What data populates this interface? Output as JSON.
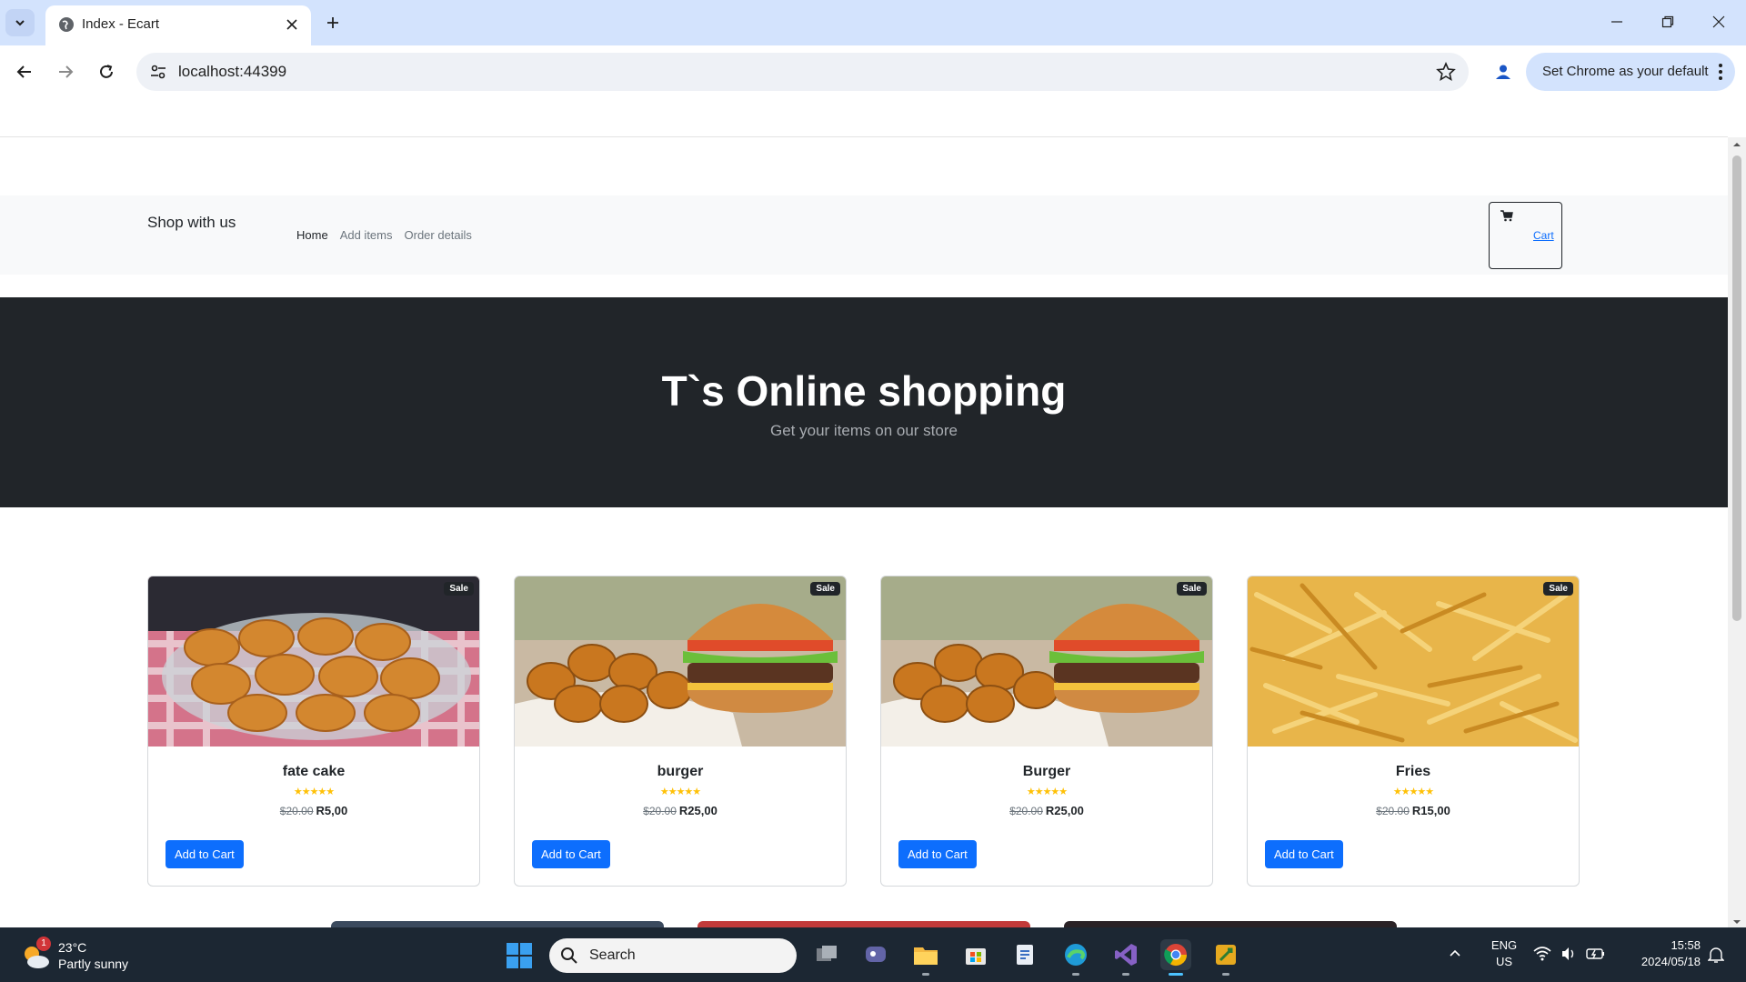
{
  "browser": {
    "tab_title": "Index - Ecart",
    "url": "localhost:44399",
    "default_prompt": "Set Chrome as your default"
  },
  "site": {
    "brand": "Shop with us",
    "nav": [
      "Home",
      "Add items",
      "Order details"
    ],
    "cart_label": "Cart"
  },
  "hero": {
    "title": "T`s Online shopping",
    "subtitle": "Get your items on our store"
  },
  "products": [
    {
      "name": "fate cake",
      "badge": "Sale",
      "old_price": "$20.00",
      "price": "R5,00",
      "rating": 5,
      "button": "Add to Cart",
      "image": "fried-dough-vetkoek-photo"
    },
    {
      "name": "burger",
      "badge": "Sale",
      "old_price": "$20.00",
      "price": "R25,00",
      "rating": 5,
      "button": "Add to Cart",
      "image": "burger-and-nuggets-photo"
    },
    {
      "name": "Burger",
      "badge": "Sale",
      "old_price": "$20.00",
      "price": "R25,00",
      "rating": 5,
      "button": "Add to Cart",
      "image": "burger-and-nuggets-photo"
    },
    {
      "name": "Fries",
      "badge": "Sale",
      "old_price": "$20.00",
      "price": "R15,00",
      "rating": 5,
      "button": "Add to Cart",
      "image": "french-fries-photo"
    }
  ],
  "taskbar": {
    "weather_temp": "23°C",
    "weather_desc": "Partly sunny",
    "weather_badge": "1",
    "search_label": "Search",
    "lang_1": "ENG",
    "lang_2": "US",
    "time": "15:58",
    "date": "2024/05/18"
  },
  "colors": {
    "tabstrip": "#d3e3fd",
    "hero_bg": "#212529",
    "primary": "#0d6efd",
    "star": "#ffc107",
    "taskbar": "#1c2733"
  }
}
